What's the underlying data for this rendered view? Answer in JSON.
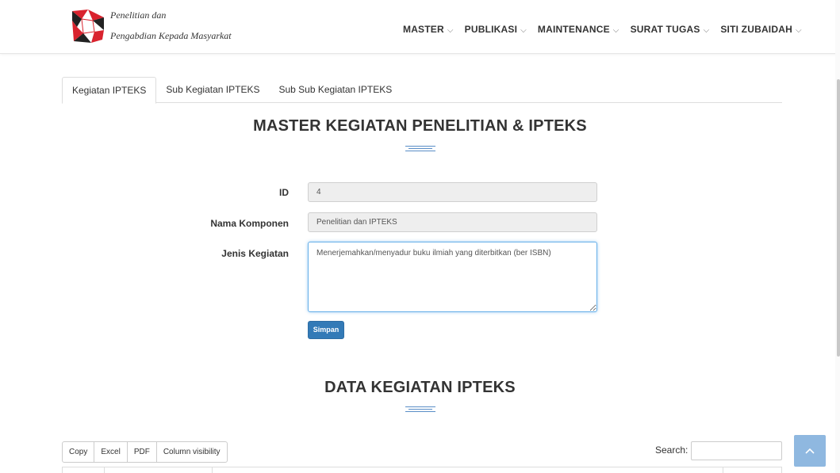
{
  "brand": {
    "line1": "Penelitian dan",
    "line2": "Pengabdian Kepada Masyarkat",
    "logo_colors": [
      "#d9232e",
      "#ffffff",
      "#222222"
    ]
  },
  "nav": {
    "items": [
      {
        "label": "MASTER"
      },
      {
        "label": "PUBLIKASI"
      },
      {
        "label": "MAINTENANCE"
      },
      {
        "label": "SURAT TUGAS"
      },
      {
        "label": "SITI ZUBAIDAH"
      }
    ]
  },
  "tabs": [
    {
      "label": "Kegiatan IPTEKS",
      "active": true
    },
    {
      "label": "Sub Kegiatan IPTEKS",
      "active": false
    },
    {
      "label": "Sub Sub Kegiatan IPTEKS",
      "active": false
    }
  ],
  "form": {
    "title": "MASTER KEGIATAN PENELITIAN & IPTEKS",
    "id_label": "ID",
    "id_value": "4",
    "nama_label": "Nama Komponen",
    "nama_value": "Penelitian dan IPTEKS",
    "jenis_label": "Jenis Kegiatan",
    "jenis_value": "Menerjemahkan/menyadur buku ilmiah yang diterbitkan (ber ISBN)",
    "save_label": "Simpan"
  },
  "data_section": {
    "title": "DATA KEGIATAN IPTEKS",
    "buttons": [
      {
        "label": "Copy"
      },
      {
        "label": "Excel"
      },
      {
        "label": "PDF"
      },
      {
        "label": "Column visibility"
      }
    ],
    "search_label": "Search:",
    "search_value": ""
  },
  "colors": {
    "accent": "#337ab7",
    "focus": "#66afe9",
    "deco": "#5a8ec7",
    "back_top": "#8fb8e0"
  }
}
